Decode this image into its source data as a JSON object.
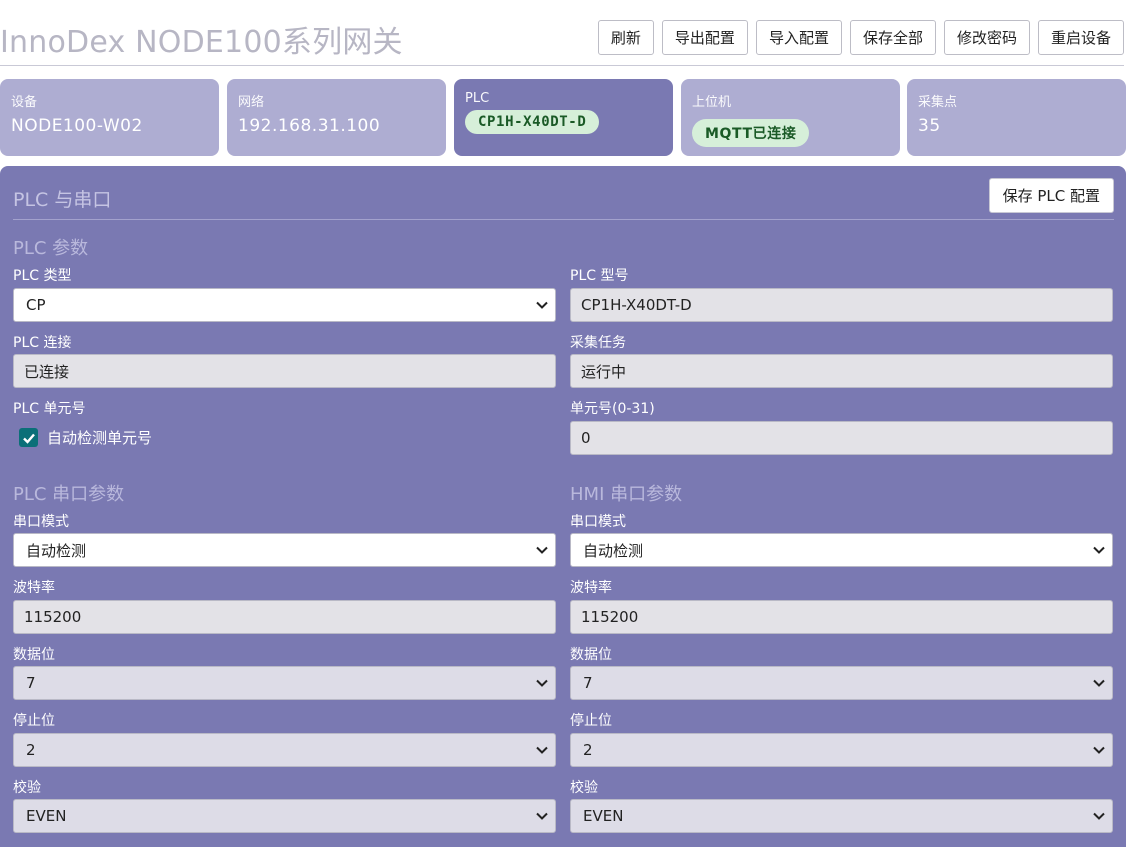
{
  "app": {
    "title": "InnoDex NODE100系列网关"
  },
  "toolbar": {
    "refresh": "刷新",
    "export_config": "导出配置",
    "import_config": "导入配置",
    "save_all": "保存全部",
    "change_password": "修改密码",
    "reboot": "重启设备"
  },
  "cards": {
    "device": {
      "label": "设备",
      "value": "NODE100-W02"
    },
    "network": {
      "label": "网络",
      "value": "192.168.31.100"
    },
    "plc": {
      "label": "PLC",
      "value": "CP1H-X40DT-D"
    },
    "host": {
      "label": "上位机",
      "value": "MQTT已连接"
    },
    "points": {
      "label": "采集点",
      "value": "35"
    }
  },
  "panel": {
    "title": "PLC 与串口",
    "save_button": "保存 PLC 配置",
    "plc_params_title": "PLC 参数",
    "plc_type": {
      "label": "PLC 类型",
      "value": "CP"
    },
    "plc_model": {
      "label": "PLC 型号",
      "value": "CP1H-X40DT-D"
    },
    "plc_connection": {
      "label": "PLC 连接",
      "value": "已连接"
    },
    "collect_task": {
      "label": "采集任务",
      "value": "运行中"
    },
    "plc_unit": {
      "label": "PLC 单元号",
      "checkbox_label": "自动检测单元号",
      "checked": true
    },
    "unit_number": {
      "label": "单元号(0-31)",
      "value": "0"
    },
    "plc_serial": {
      "title": "PLC 串口参数",
      "mode": {
        "label": "串口模式",
        "value": "自动检测"
      },
      "baud": {
        "label": "波特率",
        "value": "115200"
      },
      "databits": {
        "label": "数据位",
        "value": "7"
      },
      "stopbits": {
        "label": "停止位",
        "value": "2"
      },
      "parity": {
        "label": "校验",
        "value": "EVEN"
      }
    },
    "hmi_serial": {
      "title": "HMI 串口参数",
      "mode": {
        "label": "串口模式",
        "value": "自动检测"
      },
      "baud": {
        "label": "波特率",
        "value": "115200"
      },
      "databits": {
        "label": "数据位",
        "value": "7"
      },
      "stopbits": {
        "label": "停止位",
        "value": "2"
      },
      "parity": {
        "label": "校验",
        "value": "EVEN"
      }
    }
  },
  "colors": {
    "accent": "#7a79b2",
    "card": "#aeadd2",
    "badge_bg": "#d6efd9",
    "checkbox": "#0b6f78"
  }
}
